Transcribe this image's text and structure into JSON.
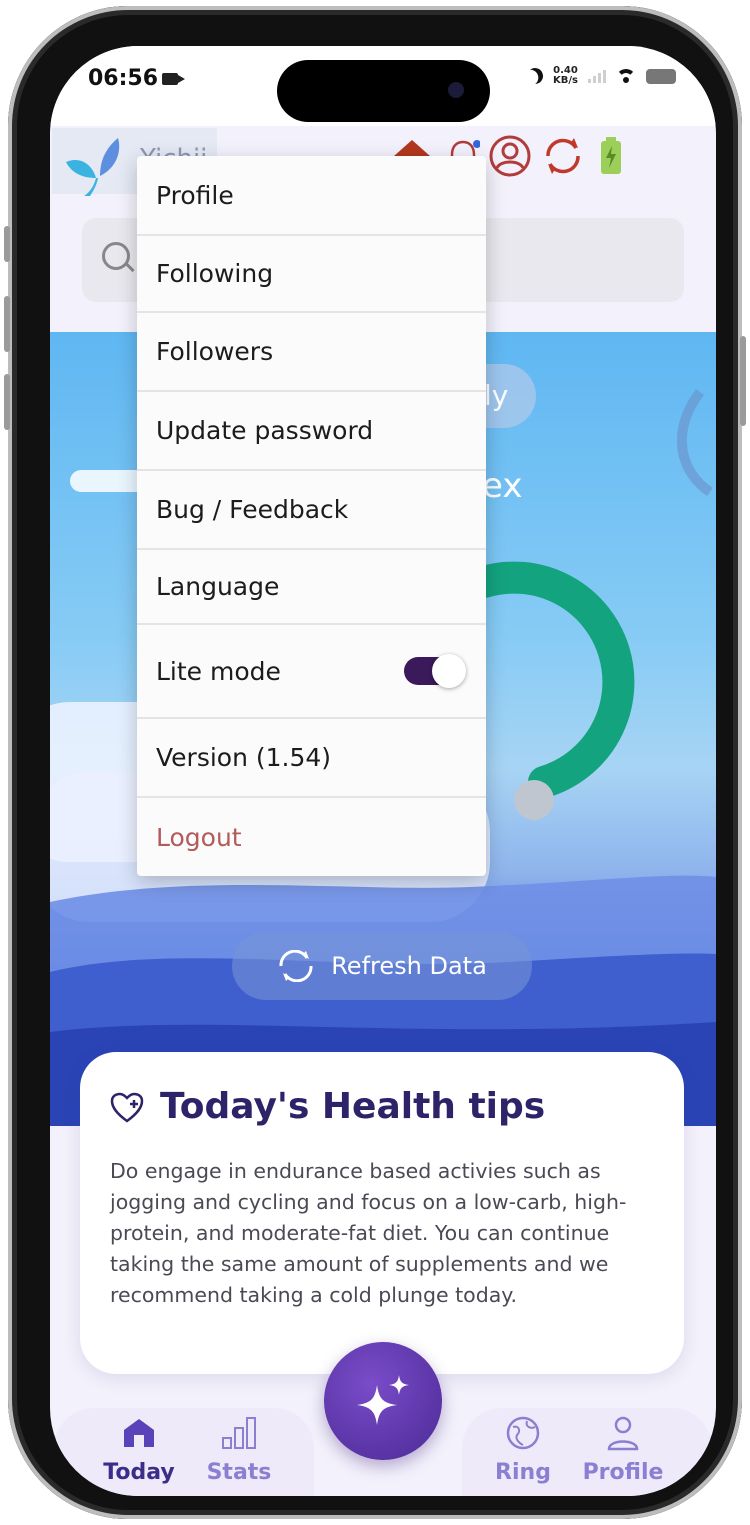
{
  "status_bar": {
    "time": "06:56",
    "net_speed_value": "0.40",
    "net_speed_unit": "KB/s"
  },
  "header": {
    "brand_name": "Yichii"
  },
  "hero": {
    "pill_text": "ly",
    "index_text_fragment": "ex",
    "refresh_label": "Refresh Data",
    "gauge_color": "#14a37f"
  },
  "dropdown_menu": {
    "items": [
      {
        "label": "Profile"
      },
      {
        "label": "Following"
      },
      {
        "label": "Followers"
      },
      {
        "label": "Update password"
      },
      {
        "label": "Bug / Feedback"
      },
      {
        "label": "Language"
      },
      {
        "label": "Lite mode",
        "toggle_on": true
      },
      {
        "label": "Version (1.54)"
      },
      {
        "label": "Logout",
        "color": "#b35a5a"
      }
    ]
  },
  "health_tips": {
    "title": "Today's Health tips",
    "body": "Do engage in endurance based activies such as jogging and cycling and focus on a low-carb, high-protein, and moderate-fat diet. You can continue taking the same amount of supplements and we recommend taking a cold plunge today."
  },
  "tab_bar": {
    "tabs": [
      {
        "label": "Today",
        "icon": "home-icon",
        "active": true
      },
      {
        "label": "Stats",
        "icon": "stats-icon",
        "active": false
      },
      {
        "label": "Ring",
        "icon": "ring-icon",
        "active": false
      },
      {
        "label": "Profile",
        "icon": "person-icon",
        "active": false
      }
    ],
    "fab_icon": "sparkles-icon"
  },
  "colors": {
    "accent": "#3d2a8a",
    "tab_active": "#3b2e8a",
    "tab_inactive": "#8a7fd0",
    "logout": "#b35a5a",
    "toggle_track": "#3a1a5a"
  }
}
